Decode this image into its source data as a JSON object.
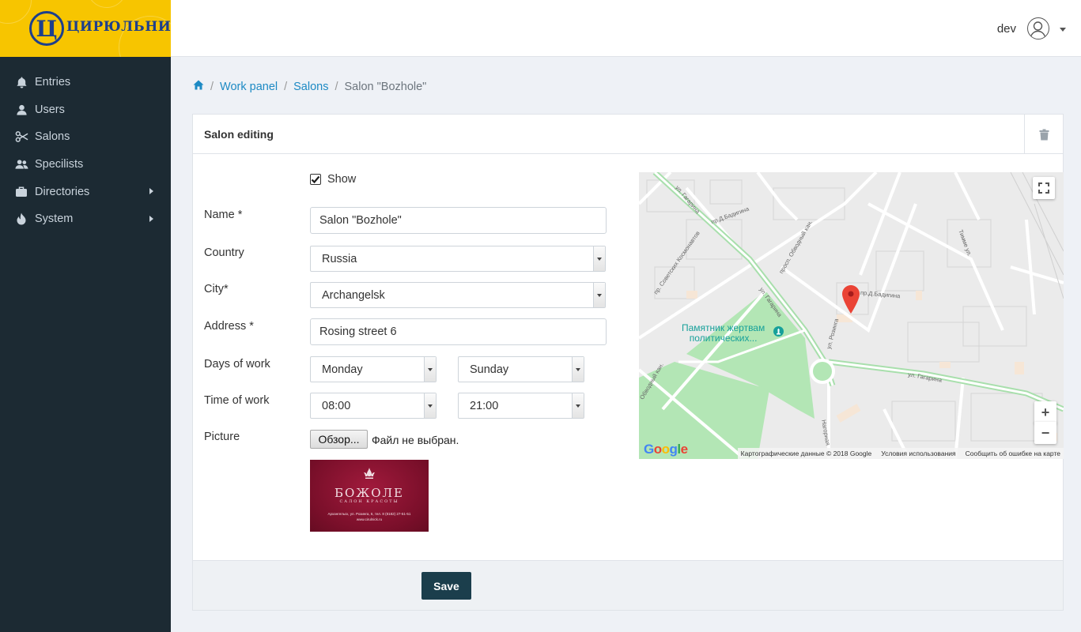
{
  "brand": {
    "logo_letter": "Ц",
    "logo_text": "ЦИРЮЛЬНИКЪ"
  },
  "header": {
    "user_name": "dev"
  },
  "sidebar": {
    "items": [
      {
        "label": "Entries",
        "icon": "bell-icon",
        "has_submenu": false
      },
      {
        "label": "Users",
        "icon": "user-icon",
        "has_submenu": false
      },
      {
        "label": "Salons",
        "icon": "scissors-icon",
        "has_submenu": false
      },
      {
        "label": "Specilists",
        "icon": "users-icon",
        "has_submenu": false
      },
      {
        "label": "Directories",
        "icon": "briefcase-icon",
        "has_submenu": true
      },
      {
        "label": "System",
        "icon": "fire-icon",
        "has_submenu": true
      }
    ]
  },
  "breadcrumb": {
    "home_icon": "home-icon",
    "items": [
      "Work panel",
      "Salons"
    ],
    "current": "Salon \"Bozhole\""
  },
  "card": {
    "title": "Salon editing",
    "delete_icon": "trash-icon"
  },
  "form": {
    "show": {
      "label": "Show",
      "checked": true
    },
    "name": {
      "label": "Name *",
      "value": "Salon \"Bozhole\""
    },
    "country": {
      "label": "Country",
      "value": "Russia"
    },
    "city": {
      "label": "City*",
      "value": "Archangelsk"
    },
    "address": {
      "label": "Address *",
      "value": "Rosing street 6"
    },
    "days": {
      "label": "Days of work",
      "from": "Monday",
      "to": "Sunday"
    },
    "time": {
      "label": "Time of work",
      "from": "08:00",
      "to": "21:00"
    },
    "picture": {
      "label": "Picture",
      "button": "Обзор...",
      "status": "Файл не выбран.",
      "thumb_title": "БОЖОЛЕ",
      "thumb_subtitle": "САЛОН КРАСОТЫ",
      "thumb_address": "Архангельск, ул. Розинга, 6, тел. 8 (8182) 27-51-51",
      "thumb_site": "www.cirulnick.ru"
    },
    "save_label": "Save"
  },
  "map": {
    "poi": "Памятник жертвам\nполитических...",
    "streets": [
      "ул. Гагарина",
      "ул. Гагарина",
      "ул. Гагарина",
      "пр. Советских Космонавтов",
      "просп. Обводный кан.",
      "ул. Розинга",
      "пр.Д.Бадигина",
      "пр.Д.Бадигина",
      "Тимме ул.",
      "Нагорная",
      "Обводный кан."
    ],
    "footer": {
      "data": "Картографические данные © 2018 Google",
      "terms": "Условия использования",
      "report": "Сообщить об ошибке на карте"
    },
    "google_logo": "Google",
    "zoom_in": "+",
    "zoom_out": "−"
  }
}
